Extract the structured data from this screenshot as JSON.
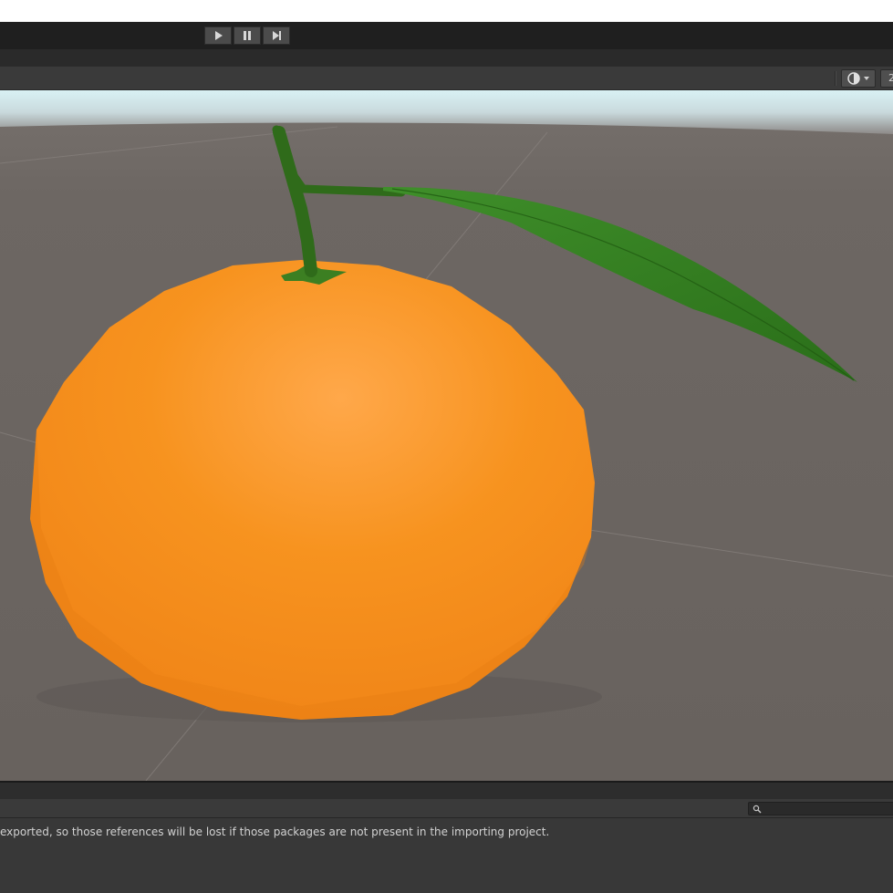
{
  "toolbar": {
    "play_icon": "play-icon",
    "pause_icon": "pause-icon",
    "step_icon": "step-forward-icon"
  },
  "scene_toolbar": {
    "shading_icon": "shading-sphere-icon",
    "twod_label": "2"
  },
  "scene": {
    "object": "tangerine-model",
    "colors": {
      "ground": "#6b6561",
      "sky": "#d7eef1",
      "orange": "#f5921f",
      "leaf": "#2e7d1e",
      "stem": "#2f6b1a"
    }
  },
  "console": {
    "message": "exported, so those references will be lost if those packages are not present in the importing project.",
    "search_icon": "search-icon",
    "search_value": ""
  }
}
